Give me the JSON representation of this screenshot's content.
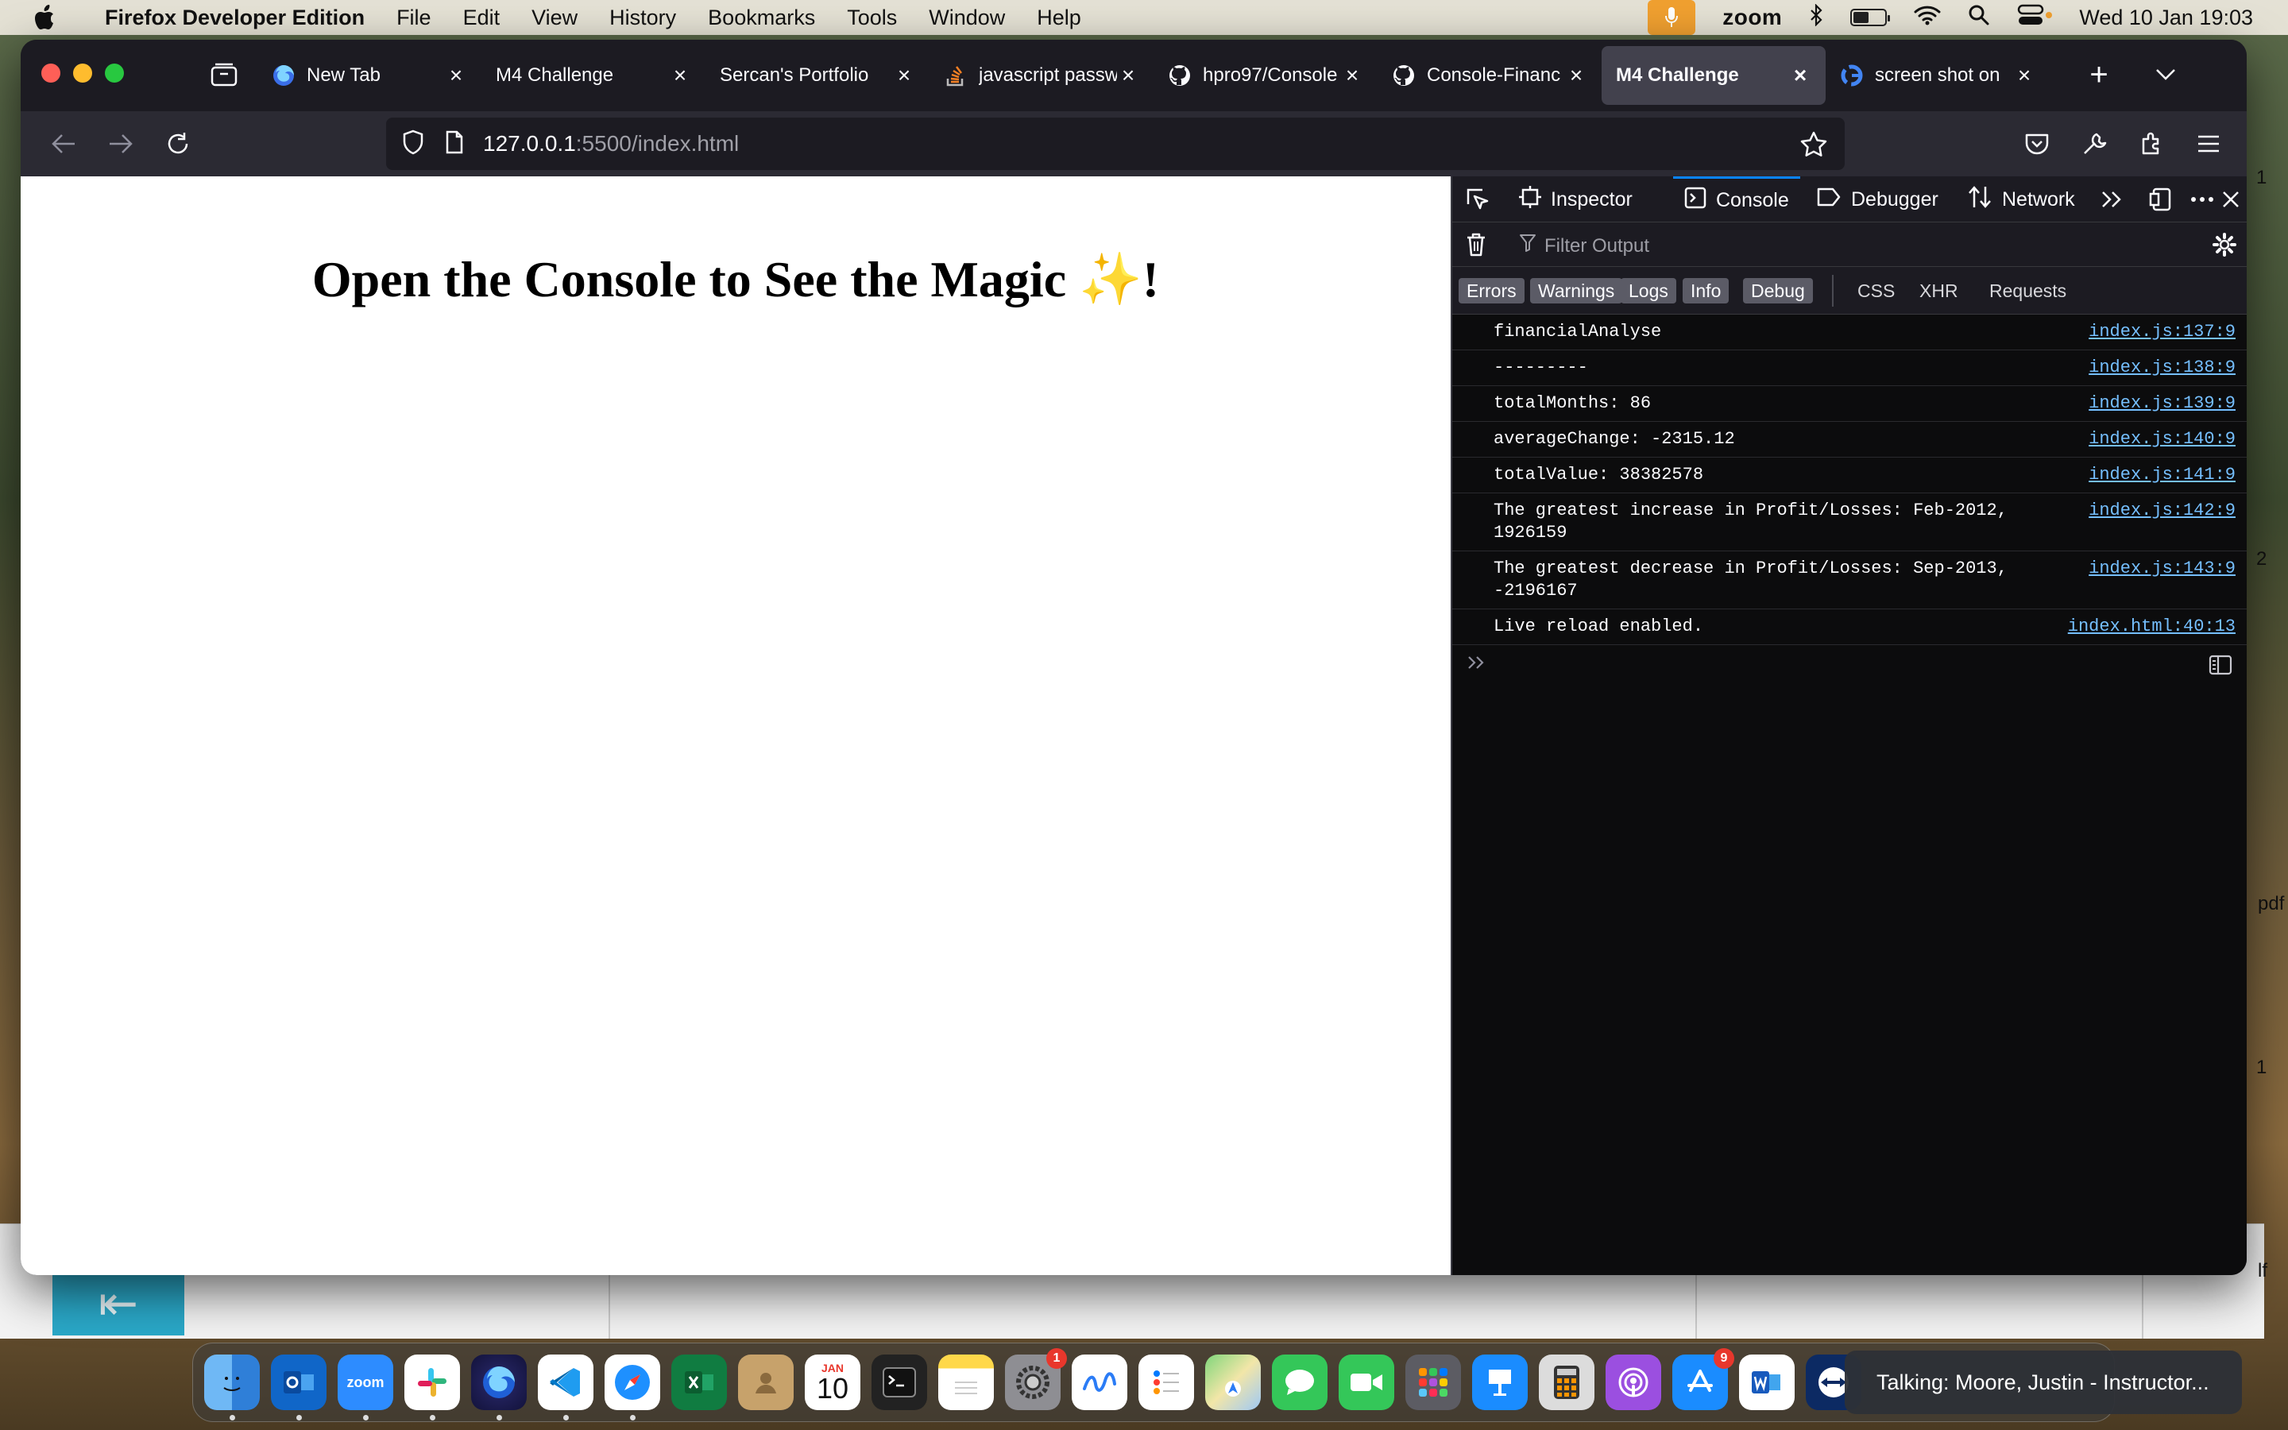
{
  "menubar": {
    "app_name": "Firefox Developer Edition",
    "menus": [
      "File",
      "Edit",
      "View",
      "History",
      "Bookmarks",
      "Tools",
      "Window",
      "Help"
    ],
    "zoom_label": "zoom",
    "datetime": "Wed 10 Jan  19:03",
    "battery_level": 0.5
  },
  "tabs": [
    {
      "title": "New Tab",
      "icon": "firefox-icon",
      "active": false
    },
    {
      "title": "M4 Challenge",
      "icon": "none",
      "active": false
    },
    {
      "title": "Sercan's Portfolio",
      "icon": "none",
      "active": false
    },
    {
      "title": "javascript passw",
      "icon": "stackoverflow-icon",
      "active": false
    },
    {
      "title": "hpro97/Console",
      "icon": "github-icon",
      "active": false
    },
    {
      "title": "Console-Financ",
      "icon": "github-icon",
      "active": false
    },
    {
      "title": "M4 Challenge",
      "icon": "none",
      "active": true
    },
    {
      "title": "screen shot on",
      "icon": "google-icon",
      "active": false
    }
  ],
  "url": {
    "host": "127.0.0.1",
    "rest": ":5500/index.html"
  },
  "page": {
    "heading": "Open the Console to See the Magic ✨!"
  },
  "devtools": {
    "tabs": {
      "inspector": "Inspector",
      "console": "Console",
      "debugger": "Debugger",
      "network": "Network"
    },
    "filter_placeholder": "Filter Output",
    "levels": [
      "Errors",
      "Warnings",
      "Logs",
      "Info",
      "Debug"
    ],
    "extra_filters": [
      "CSS",
      "XHR",
      "Requests"
    ],
    "messages": [
      {
        "text": "financialAnalyse",
        "source": "index.js:137:9"
      },
      {
        "text": "---------",
        "source": "index.js:138:9"
      },
      {
        "text": "totalMonths: 86",
        "source": "index.js:139:9"
      },
      {
        "text": "averageChange: -2315.12",
        "source": "index.js:140:9"
      },
      {
        "text": "totalValue: 38382578",
        "source": "index.js:141:9"
      },
      {
        "text": "The greatest increase in Profit/Losses: Feb-2012,\n1926159",
        "source": "index.js:142:9"
      },
      {
        "text": "The greatest decrease in Profit/Losses: Sep-2013,\n-2196167",
        "source": "index.js:143:9"
      },
      {
        "text": "Live reload enabled.",
        "source": "index.html:40:13"
      }
    ]
  },
  "dock": {
    "calendar_month": "JAN",
    "calendar_day": "10",
    "settings_badge": "1",
    "appstore_badge": "9",
    "zoom_app_label": "zoom"
  },
  "zoom_toast": "Talking: Moore, Justin - Instructor...",
  "side_fragments": [
    "1",
    "2",
    "pdf",
    "1",
    "lf"
  ]
}
